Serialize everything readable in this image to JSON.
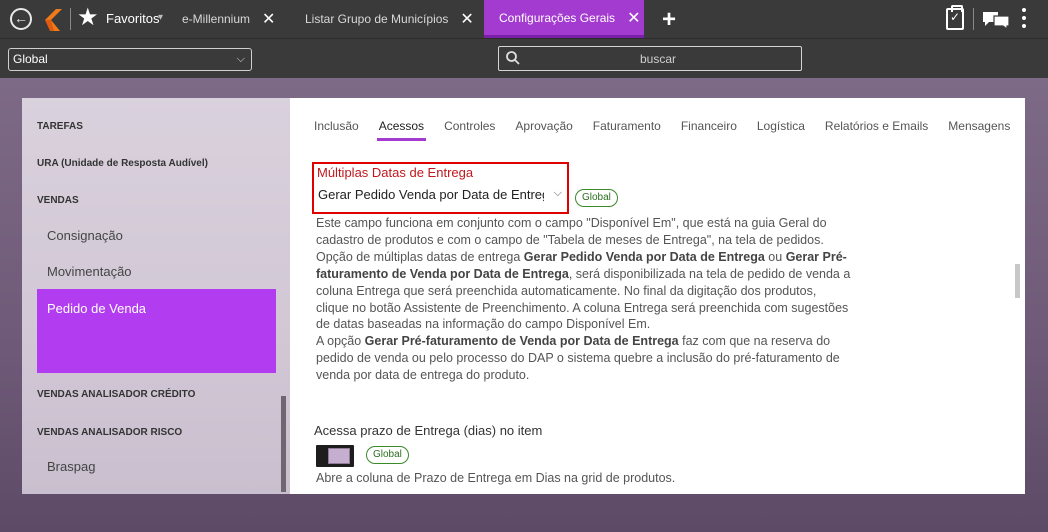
{
  "top_bar": {
    "favorites_label": "Favoritos",
    "tabs": [
      {
        "label": "e-Millennium",
        "active": false
      },
      {
        "label": "Listar Grupo de Municípios",
        "active": false
      },
      {
        "label": "Configurações Gerais",
        "active": true
      }
    ],
    "close_glyph": "✕",
    "add_tab_glyph": "+",
    "accent_color": "#a33bd0",
    "icons": [
      "back-arrow-icon",
      "logo-icon",
      "star-icon",
      "clipboard-check-icon",
      "chat-icon",
      "kebab-menu-icon"
    ]
  },
  "sub_bar": {
    "scope_select": "Global",
    "search_placeholder": "buscar"
  },
  "sidebar": {
    "items": [
      {
        "label": "TAREFAS",
        "type": "section"
      },
      {
        "label": "URA (Unidade de Resposta Audível)",
        "type": "section"
      },
      {
        "label": "VENDAS",
        "type": "section"
      },
      {
        "label": "Consignação",
        "type": "sub"
      },
      {
        "label": "Movimentação",
        "type": "sub"
      },
      {
        "label": "Pedido de Venda",
        "type": "sub",
        "active": true
      },
      {
        "label": "VENDAS ANALISADOR CRÉDITO",
        "type": "section"
      },
      {
        "label": "VENDAS ANALISADOR RISCO",
        "type": "section"
      },
      {
        "label": "Braspag",
        "type": "sub"
      }
    ],
    "active_color": "#b23df0"
  },
  "content_tabs": [
    {
      "label": "Inclusão",
      "active": false
    },
    {
      "label": "Acessos",
      "active": true
    },
    {
      "label": "Controles",
      "active": false
    },
    {
      "label": "Aprovação",
      "active": false
    },
    {
      "label": "Faturamento",
      "active": false
    },
    {
      "label": "Financeiro",
      "active": false
    },
    {
      "label": "Logística",
      "active": false
    },
    {
      "label": "Relatórios e Emails",
      "active": false
    },
    {
      "label": "Mensagens",
      "active": false
    }
  ],
  "field1": {
    "title": "Múltiplas Datas de Entrega",
    "selected_value": "Gerar Pedido Venda por Data de Entrega",
    "badge": "Global",
    "description": {
      "p1": "Este campo funciona em conjunto com o campo \"Disponível Em\", que está na guia Geral do cadastro de produtos e com o campo de \"Tabela de meses de Entrega\", na tela de pedidos.",
      "p2_prefix": "Opção de múltiplas datas de entrega ",
      "p2_bold1": "Gerar Pedido Venda por Data de Entrega",
      "p2_mid": " ou ",
      "p2_bold2": "Gerar Pré-faturamento de Venda por Data de Entrega",
      "p2_suffix": ", será disponibilizada na tela de pedido de venda a coluna Entrega que será preenchida automaticamente. No final da digitação dos produtos, clique no botão Assistente de Preenchimento. A coluna Entrega será preenchida com sugestões de datas baseadas na informação do campo Disponível Em.",
      "p3_prefix": "A opção ",
      "p3_bold": "Gerar Pré-faturamento de Venda por Data de Entrega",
      "p3_suffix": " faz com que na reserva do pedido de venda ou pelo processo do DAP o sistema quebre a inclusão do pré-faturamento de venda por data de entrega do produto."
    },
    "highlight_color": "#e00000"
  },
  "field2": {
    "title": "Acessa prazo de Entrega (dias) no item",
    "badge": "Global",
    "toggle_on": true,
    "description": "Abre a coluna de Prazo de Entrega em Dias na grid de produtos."
  }
}
